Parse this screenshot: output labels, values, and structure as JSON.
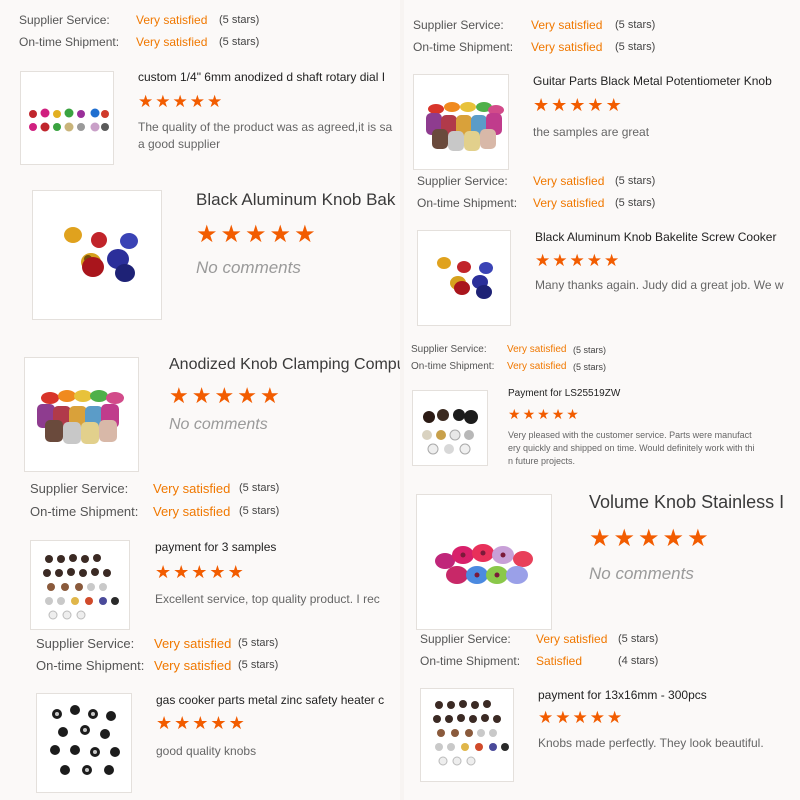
{
  "labels": {
    "supplier": "Supplier Service:",
    "shipment": "On-time Shipment:"
  },
  "colors": {
    "accent": "#f07800",
    "star": "#f25c00"
  },
  "star_glyph": "★",
  "reviews": [
    {
      "id": "r1",
      "ratings": {
        "supplier": {
          "value": "Very satisfied",
          "count": "(5 stars)"
        },
        "shipment": {
          "value": "Very satisfied",
          "count": "(5 stars)"
        }
      },
      "title": "custom 1/4\" 6mm anodized d shaft rotary dial I",
      "stars": 5,
      "comment": "The quality of the product was as agreed,it is sa",
      "comment2": "a good supplier"
    },
    {
      "id": "r2",
      "title": "Black Aluminum Knob Bak",
      "stars": 5,
      "comment": "No comments"
    },
    {
      "id": "r3",
      "title": "Anodized Knob Clamping Comput",
      "stars": 5,
      "comment": "No comments"
    },
    {
      "id": "r4",
      "ratings": {
        "supplier": {
          "value": "Very satisfied",
          "count": "(5 stars)"
        },
        "shipment": {
          "value": "Very satisfied",
          "count": "(5 stars)"
        }
      },
      "title": "payment for 3 samples",
      "stars": 5,
      "comment": "Excellent service, top quality product. I rec"
    },
    {
      "id": "r5",
      "ratings": {
        "supplier": {
          "value": "Very satisfied",
          "count": "(5 stars)"
        },
        "shipment": {
          "value": "Very satisfied",
          "count": "(5 stars)"
        }
      },
      "title": "gas cooker parts metal zinc safety heater c",
      "stars": 5,
      "comment": "good quality knobs"
    },
    {
      "id": "r6",
      "ratings": {
        "supplier": {
          "value": "Very satisfied",
          "count": "(5 stars)"
        },
        "shipment": {
          "value": "Very satisfied",
          "count": "(5 stars)"
        }
      },
      "title": "Guitar Parts Black Metal Potentiometer Knob",
      "stars": 5,
      "comment": "the samples are great"
    },
    {
      "id": "r7",
      "ratings": {
        "supplier": {
          "value": "Very satisfied",
          "count": "(5 stars)"
        },
        "shipment": {
          "value": "Very satisfied",
          "count": "(5 stars)"
        }
      },
      "title": "Black Aluminum Knob Bakelite Screw Cooker",
      "stars": 5,
      "comment": "Many thanks again. Judy did a great job. We w"
    },
    {
      "id": "r8",
      "ratings": {
        "supplier": {
          "value": "Very satisfied",
          "count": "(5 stars)"
        },
        "shipment": {
          "value": "Very satisfied",
          "count": "(5 stars)"
        }
      },
      "title": "Payment for LS25519ZW",
      "stars": 5,
      "comment": "Very pleased with the customer service. Parts were manufact",
      "comment2": "ery quickly and shipped on time. Would definitely work with thi",
      "comment3": "n future projects."
    },
    {
      "id": "r9",
      "title": "Volume Knob Stainless I",
      "stars": 5,
      "comment": "No comments"
    },
    {
      "id": "r10",
      "ratings": {
        "supplier": {
          "value": "Very satisfied",
          "count": "(5 stars)"
        },
        "shipment": {
          "value": "Satisfied",
          "count": "(4 stars)"
        }
      },
      "title": "payment for 13x16mm - 300pcs",
      "stars": 5,
      "comment": "Knobs made perfectly. They look beautiful."
    }
  ]
}
